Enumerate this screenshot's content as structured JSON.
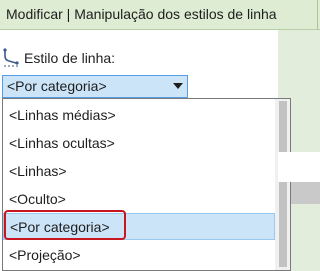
{
  "title_bar": {
    "title": "Modificar | Manipulação dos estilos de linha"
  },
  "line_style": {
    "icon": "line-style-icon",
    "label": "Estilo de linha:",
    "selected_value": "<Por categoria>"
  },
  "dropdown": {
    "options": [
      "<Linhas médias>",
      "<Linhas ocultas>",
      "<Linhas>",
      "<Oculto>",
      "<Por categoria>",
      "<Projeção>"
    ],
    "highlighted_index": 4
  },
  "colors": {
    "ribbon_green": "#ddecd3",
    "selection_blue": "#cce4f7",
    "selection_border": "#569de5",
    "annotation_red": "#c8151f"
  }
}
